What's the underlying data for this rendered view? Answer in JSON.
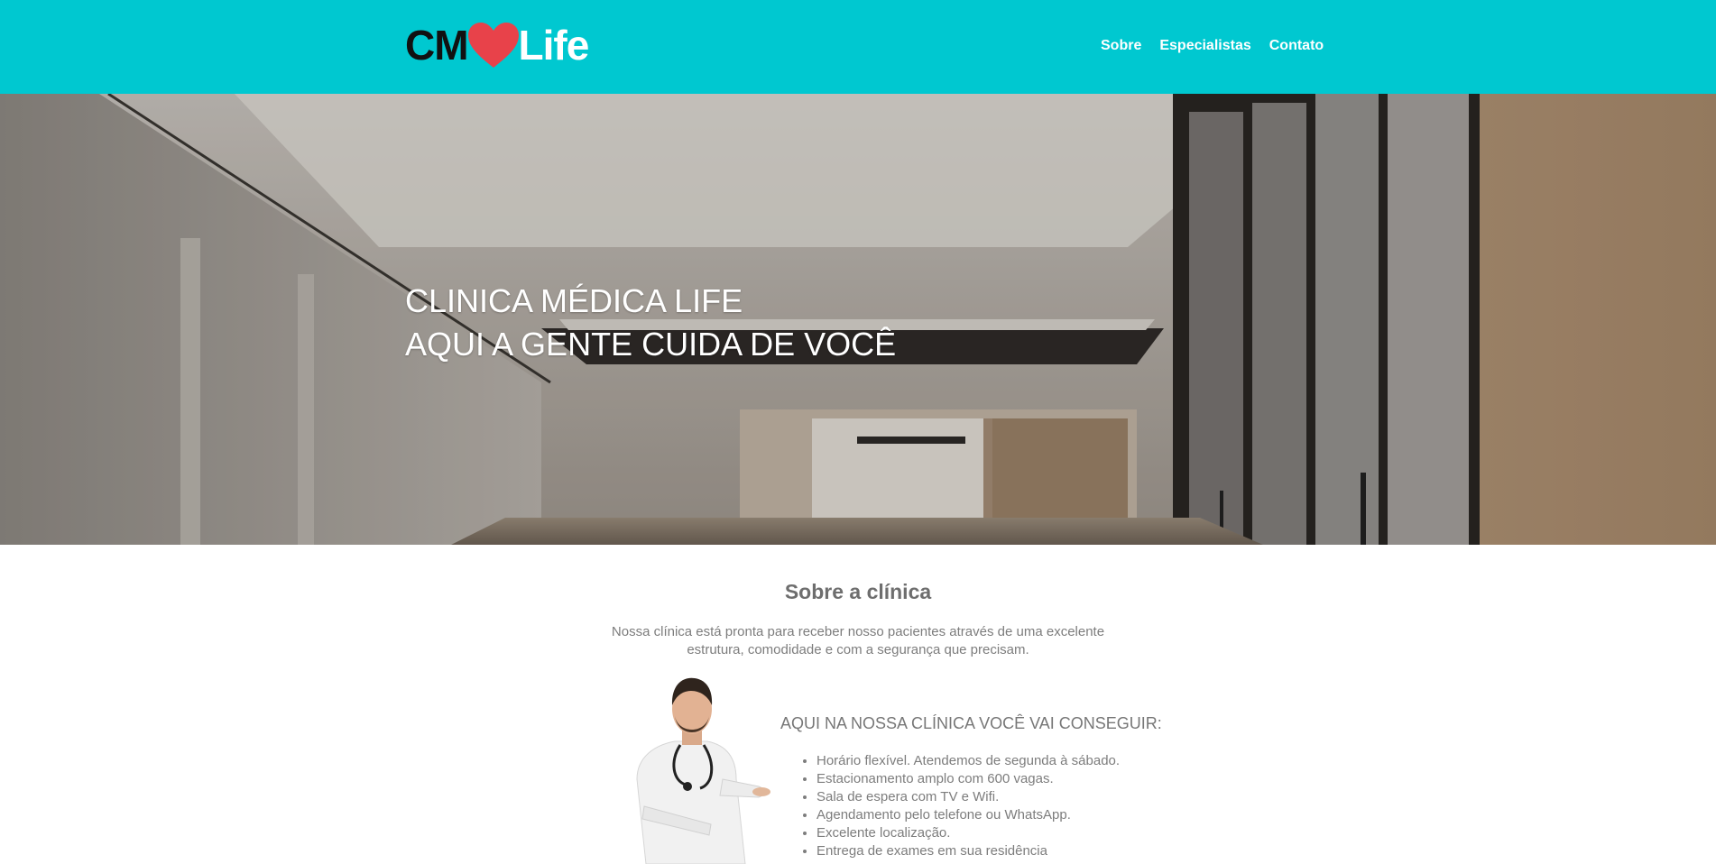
{
  "logo": {
    "part1": "CM",
    "part2": "Life"
  },
  "nav": {
    "items": [
      "Sobre",
      "Especialistas",
      "Contato"
    ]
  },
  "hero": {
    "line1": "CLINICA MÉDICA LIFE",
    "line2": "AQUI A GENTE CUIDA DE VOCÊ"
  },
  "about": {
    "title": "Sobre a clínica",
    "description": "Nossa clínica está pronta para receber nosso pacientes através de uma excelente estrutura, comodidade e com a segurança que precisam.",
    "benefits_title": "AQUI NA NOSSA CLÍNICA VOCÊ VAI CONSEGUIR:",
    "benefits": [
      "Horário flexível. Atendemos de segunda à sábado.",
      "Estacionamento amplo com 600 vagas.",
      "Sala de espera com TV e Wifi.",
      "Agendamento pelo telefone ou WhatsApp.",
      "Excelente localização.",
      "Entrega de exames em sua residência"
    ]
  },
  "colors": {
    "header_bg": "#00c8d0",
    "heart": "#e8424a"
  },
  "icons": {
    "logo_heart": "heart-icon"
  }
}
